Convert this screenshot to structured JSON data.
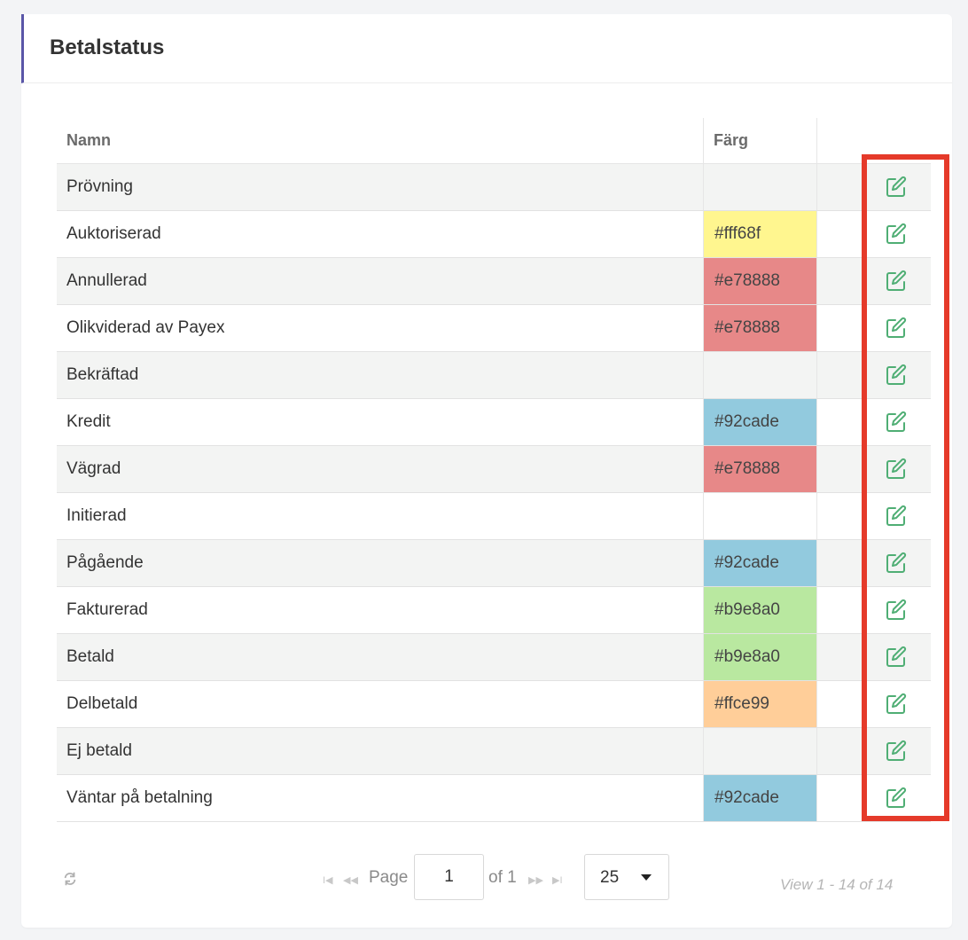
{
  "panel": {
    "title": "Betalstatus"
  },
  "table": {
    "headers": {
      "name": "Namn",
      "color": "Färg"
    },
    "rows": [
      {
        "name": "Prövning",
        "color": ""
      },
      {
        "name": "Auktoriserad",
        "color": "#fff68f"
      },
      {
        "name": "Annullerad",
        "color": "#e78888"
      },
      {
        "name": "Olikviderad av Payex",
        "color": "#e78888"
      },
      {
        "name": "Bekräftad",
        "color": ""
      },
      {
        "name": "Kredit",
        "color": "#92cade"
      },
      {
        "name": "Vägrad",
        "color": "#e78888"
      },
      {
        "name": "Initierad",
        "color": ""
      },
      {
        "name": "Pågående",
        "color": "#92cade"
      },
      {
        "name": "Fakturerad",
        "color": "#b9e8a0"
      },
      {
        "name": "Betald",
        "color": "#b9e8a0"
      },
      {
        "name": "Delbetald",
        "color": "#ffce99"
      },
      {
        "name": "Ej betald",
        "color": ""
      },
      {
        "name": "Väntar på betalning",
        "color": "#92cade"
      }
    ],
    "row_icon": "edit-icon"
  },
  "pager": {
    "page_label": "Page",
    "page_value": "1",
    "of_label": "of 1",
    "page_size": "25",
    "view_label": "View 1 - 14 of 14",
    "icons": [
      "refresh-icon",
      "first-page-icon",
      "prev-page-icon",
      "next-page-icon",
      "last-page-icon",
      "chevron-down-icon"
    ]
  },
  "colors": {
    "accent": "#5a56a8",
    "edit_icon": "#4fae74",
    "highlight": "#e53a2a",
    "row_alt": "#f3f4f3"
  }
}
